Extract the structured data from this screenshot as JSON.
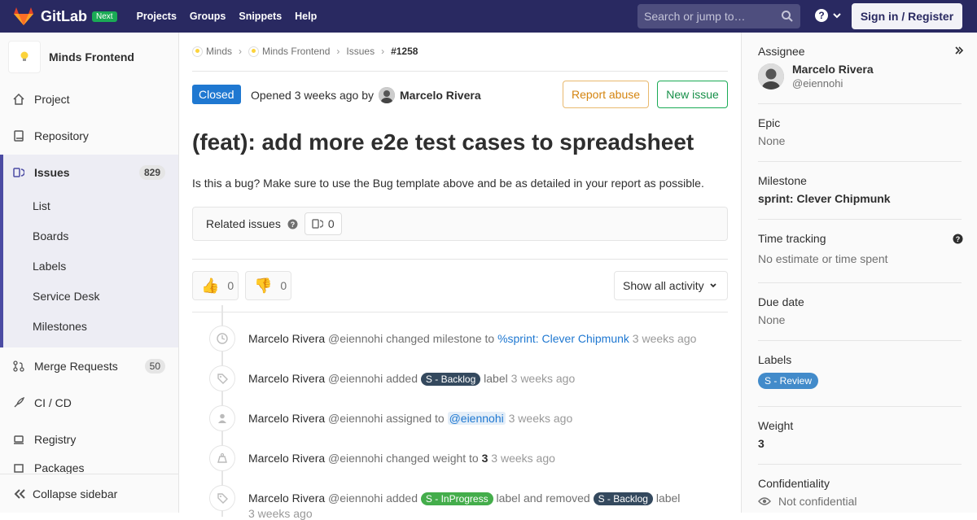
{
  "topnav": {
    "brand": "GitLab",
    "next_badge": "Next",
    "links": [
      "Projects",
      "Groups",
      "Snippets",
      "Help"
    ],
    "search_placeholder": "Search or jump to…",
    "signin": "Sign in / Register",
    "bg_color": "#292961"
  },
  "sidebar": {
    "project_name": "Minds Frontend",
    "items": [
      {
        "label": "Project",
        "icon": "home-icon"
      },
      {
        "label": "Repository",
        "icon": "book-icon"
      },
      {
        "label": "Issues",
        "icon": "issues-icon",
        "count": "829"
      },
      {
        "label": "Merge Requests",
        "icon": "merge-request-icon",
        "count": "50"
      },
      {
        "label": "CI / CD",
        "icon": "rocket-icon"
      },
      {
        "label": "Registry",
        "icon": "container-icon"
      },
      {
        "label": "Packages",
        "icon": "package-icon"
      }
    ],
    "issues_sub": [
      "List",
      "Boards",
      "Labels",
      "Service Desk",
      "Milestones"
    ],
    "collapse_label": "Collapse sidebar",
    "active_color": "#4b4ba3"
  },
  "breadcrumb": {
    "items": [
      "Minds",
      "Minds Frontend",
      "Issues",
      "#1258"
    ]
  },
  "issue": {
    "status": "Closed",
    "opened_text": "Opened 3 weeks ago by",
    "author": "Marcelo Rivera",
    "report_button": "Report abuse",
    "new_button": "New issue",
    "title": "(feat): add more e2e test cases to spreadsheet",
    "description": "Is this a bug? Make sure to use the Bug template above and be as detailed in your report as possible.",
    "related_label": "Related issues",
    "related_count": "0",
    "thumbs_up_count": "0",
    "thumbs_down_count": "0",
    "activity_filter": "Show all activity"
  },
  "events": [
    {
      "who": "Marcelo Rivera",
      "handle": "@eiennohi",
      "icon": "clock-icon",
      "pre": "changed milestone to",
      "link": "%sprint: Clever Chipmunk",
      "time": "3 weeks ago"
    },
    {
      "who": "Marcelo Rivera",
      "handle": "@eiennohi",
      "icon": "tag-icon",
      "pre": "added",
      "label": "S - Backlog",
      "post": "label",
      "time": "3 weeks ago"
    },
    {
      "who": "Marcelo Rivera",
      "handle": "@eiennohi",
      "icon": "user-icon",
      "pre": "assigned to",
      "mention": "@eiennohi",
      "time": "3 weeks ago"
    },
    {
      "who": "Marcelo Rivera",
      "handle": "@eiennohi",
      "icon": "weight-icon",
      "pre": "changed weight to",
      "value": "3",
      "time": "3 weeks ago"
    },
    {
      "who": "Marcelo Rivera",
      "handle": "@eiennohi",
      "icon": "tag-icon",
      "pre": "added",
      "label": "S - InProgress",
      "mid": "label and removed",
      "label2": "S - Backlog",
      "post": "label",
      "time": "3 weeks ago"
    }
  ],
  "right": {
    "assignee_head": "Assignee",
    "assignee_name": "Marcelo Rivera",
    "assignee_user": "@eiennohi",
    "epic_head": "Epic",
    "epic_val": "None",
    "milestone_head": "Milestone",
    "milestone_val": "sprint: Clever Chipmunk",
    "time_head": "Time tracking",
    "time_val": "No estimate or time spent",
    "due_head": "Due date",
    "due_val": "None",
    "labels_head": "Labels",
    "label_val": "S - Review",
    "weight_head": "Weight",
    "weight_val": "3",
    "conf_head": "Confidentiality",
    "conf_val": "Not confidential"
  }
}
